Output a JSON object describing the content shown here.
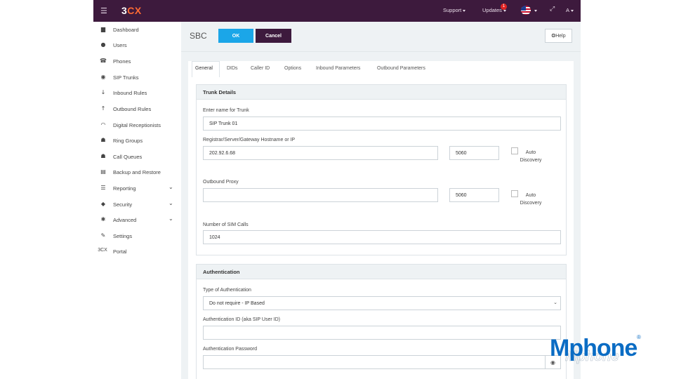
{
  "topbar": {
    "menu_icon": "hamburger-icon",
    "logo_digit": "3",
    "logo_letters": "CX",
    "support_label": "Support",
    "updates_label": "Updates",
    "updates_count": "1",
    "flag_icon": "us-flag-icon",
    "expand_icon": "expand-icon",
    "user_label": "A"
  },
  "sidebar": {
    "items": [
      {
        "label": "Dashboard",
        "icon": "bar-chart-icon",
        "glyph": "▆"
      },
      {
        "label": "Users",
        "icon": "user-icon",
        "glyph": "●"
      },
      {
        "label": "Phones",
        "icon": "phone-icon",
        "glyph": "☎"
      },
      {
        "label": "SIP Trunks",
        "icon": "globe-icon",
        "glyph": "◉"
      },
      {
        "label": "Inbound Rules",
        "icon": "arrow-down-icon",
        "glyph": "↓"
      },
      {
        "label": "Outbound Rules",
        "icon": "arrow-up-icon",
        "glyph": "↑"
      },
      {
        "label": "Digital Receptionists",
        "icon": "headset-icon",
        "glyph": "◠"
      },
      {
        "label": "Ring Groups",
        "icon": "group-icon",
        "glyph": "☗"
      },
      {
        "label": "Call Queues",
        "icon": "queue-icon",
        "glyph": "☗"
      },
      {
        "label": "Backup and Restore",
        "icon": "database-icon",
        "glyph": "▤"
      },
      {
        "label": "Reporting",
        "icon": "list-icon",
        "glyph": "☰"
      },
      {
        "label": "Security",
        "icon": "shield-icon",
        "glyph": "◆"
      },
      {
        "label": "Advanced",
        "icon": "cog-icon",
        "glyph": "✱"
      },
      {
        "label": "Settings",
        "icon": "wrench-icon",
        "glyph": "✎"
      },
      {
        "label": "Portal",
        "icon": "3cx-icon",
        "glyph": "3CX"
      }
    ],
    "expand_icon": "chevron-down-icon"
  },
  "header": {
    "title": "SBC",
    "ok_label": "OK",
    "cancel_label": "Cancel",
    "help_label": "Help"
  },
  "tabs": [
    "General",
    "DIDs",
    "Caller ID",
    "Options",
    "Inbound Parameters",
    "Outbound Parameters"
  ],
  "trunk_details": {
    "title": "Trunk Details",
    "name_label": "Enter name for Trunk",
    "name_value": "SIP Trunk 01",
    "registrar_label": "Registrar/Server/Gateway Hostname or IP",
    "registrar_value": "202.92.6.68",
    "registrar_port": "5060",
    "auto_discovery_label": "Auto Discovery",
    "outbound_proxy_label": "Outbound Proxy",
    "outbound_proxy_value": "",
    "outbound_proxy_port": "5060",
    "sim_calls_label": "Number of SIM Calls",
    "sim_calls_value": "1024"
  },
  "authentication": {
    "title": "Authentication",
    "type_label": "Type of Authentication",
    "type_value": "Do not require - IP Based",
    "auth_id_label": "Authentication ID (aka SIP User ID)",
    "auth_id_value": "",
    "password_label": "Authentication Password",
    "password_value": ""
  },
  "brand": {
    "name": "Mphone",
    "registered": "®"
  }
}
